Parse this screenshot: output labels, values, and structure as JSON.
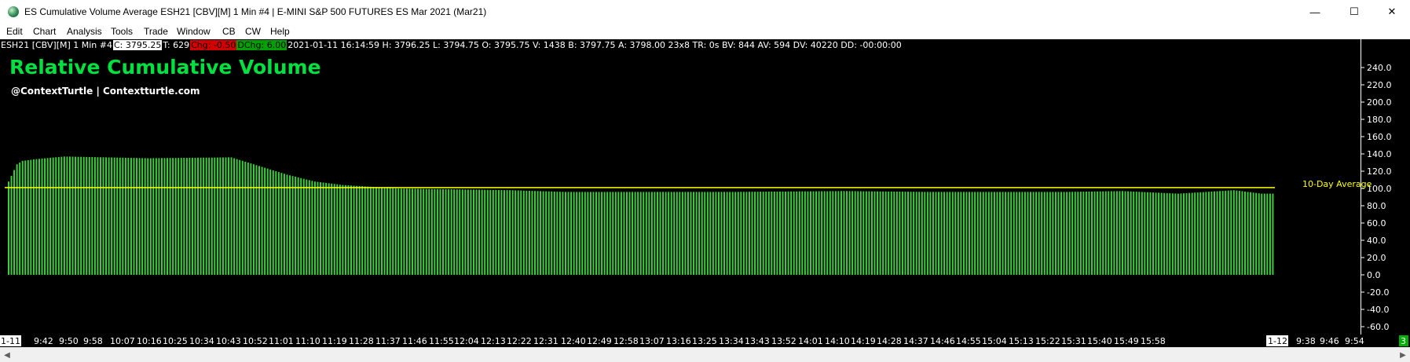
{
  "window": {
    "title": "ES Cumulative Volume Average ESH21 [CBV][M]  1 Min   #4 | E-MINI S&P 500 FUTURES ES Mar 2021 (Mar21)",
    "minimize_glyph": "—",
    "maximize_glyph": "☐",
    "close_glyph": "✕"
  },
  "menu": [
    "Edit",
    "Chart",
    "Analysis",
    "Tools",
    "Trade",
    "Window",
    "CB",
    "CW",
    "Help"
  ],
  "infobar": {
    "symbol": "ESH21 [CBV][M]  1 Min   #4",
    "close": "C: 3795.25",
    "ticks": "T: 629",
    "chg": "Chg: -0.50",
    "dchg": "DChg: 6.00",
    "details": "2021-01-11 16:14:59 H: 3796.25 L: 3794.75 O: 3795.75 V: 1438 B: 3797.75 A: 3798.00 23x8 TR: 0s BV: 844 AV: 594 DV: 40220 DD: -00:00:00"
  },
  "chart_title": "Relative Cumulative Volume",
  "chart_subtitle": "@ContextTurtle | Contextturtle.com",
  "colors": {
    "background": "#000000",
    "bars": "#3cd23c",
    "average_line": "#ffff00",
    "title": "#00e040",
    "axis_text": "#ffffff",
    "date_marker_bg": "#ffffff",
    "corner_badge": "#00b000"
  },
  "chart_data": {
    "type": "bar",
    "title": "Relative Cumulative Volume",
    "xlabel": "",
    "ylabel": "",
    "ylim": [
      -65,
      250
    ],
    "y_ticks": [
      "240.0",
      "220.0",
      "200.0",
      "180.0",
      "160.0",
      "140.0",
      "120.0",
      "100.0",
      "80.0",
      "60.0",
      "40.0",
      "20.0",
      "0.0",
      "-20.0",
      "-40.0",
      "-60.0"
    ],
    "x_labels": [
      "1-11",
      "9:42",
      "9:50",
      "9:58",
      "10:07",
      "10:16",
      "10:25",
      "10:34",
      "10:43",
      "10:52",
      "11:01",
      "11:10",
      "11:19",
      "11:28",
      "11:37",
      "11:46",
      "11:55",
      "12:04",
      "12:13",
      "12:22",
      "12:31",
      "12:40",
      "12:49",
      "12:58",
      "13:07",
      "13:16",
      "13:25",
      "13:34",
      "13:43",
      "13:52",
      "14:01",
      "14:10",
      "14:19",
      "14:28",
      "14:37",
      "14:46",
      "14:55",
      "15:04",
      "15:13",
      "15:22",
      "15:31",
      "15:40",
      "15:49",
      "15:58",
      "1-12",
      "9:38",
      "9:46",
      "9:54"
    ],
    "average_line": {
      "value": 101,
      "label": "10-Day Average"
    },
    "series_profile": {
      "x": [
        0,
        3,
        5,
        10,
        20,
        50,
        80,
        90,
        100,
        110,
        120,
        140,
        160,
        180,
        200,
        230,
        260,
        300,
        330,
        380,
        400,
        420,
        430,
        440,
        450
      ],
      "y": [
        108,
        128,
        132,
        134,
        137,
        135,
        136,
        126,
        116,
        108,
        104,
        100,
        99,
        98,
        96,
        96,
        96,
        97,
        96,
        96,
        97,
        94,
        96,
        98,
        94
      ]
    },
    "bar_count": 455
  },
  "corner_badge": "3"
}
